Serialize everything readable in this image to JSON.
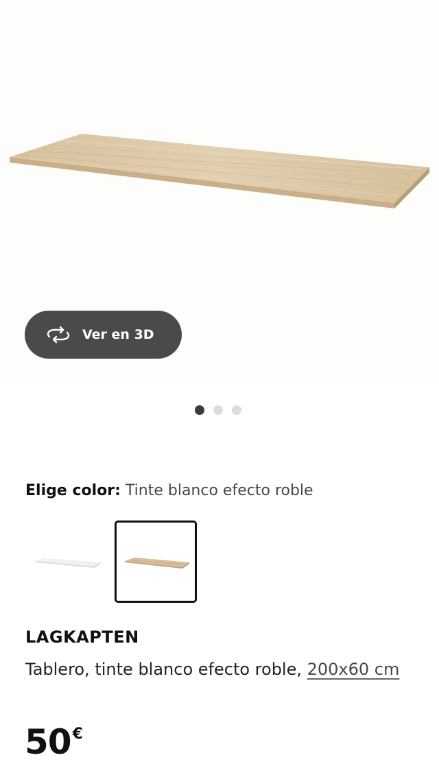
{
  "gallery": {
    "view_3d_label": "Ver en 3D",
    "slide_count": 3,
    "active_slide": 1
  },
  "color_picker": {
    "label": "Elige color:",
    "selected_value": "Tinte blanco efecto roble",
    "options": [
      {
        "name": "white",
        "color": "#f2f2f0"
      },
      {
        "name": "white-stained-oak",
        "color": "#d9c4a4",
        "selected": true
      }
    ]
  },
  "product": {
    "name": "LAGKAPTEN",
    "description": "Tablero, tinte blanco efecto roble,",
    "size_link": "200x60 cm",
    "price": "50",
    "currency": "€"
  },
  "colors": {
    "button_bg": "#4a4a4a",
    "dot_active": "#3b3b3b",
    "dot_inactive": "#dcdcdc",
    "wood_top": "#dcc8a8",
    "wood_edge": "#c7ad88"
  },
  "icons": {
    "view_3d": "rotate-3d-icon"
  }
}
